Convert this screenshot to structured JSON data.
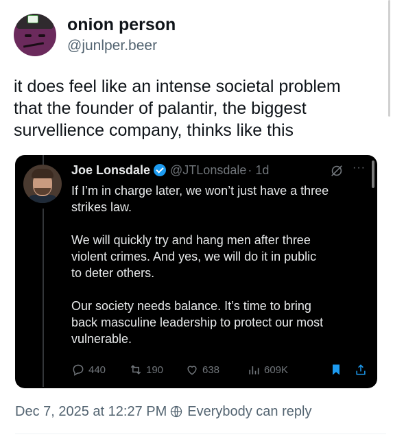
{
  "author": {
    "display_name": "onion person",
    "handle": "@junlper.beer"
  },
  "post": {
    "text": "it does feel like an intense societal problem\nthat the founder of palantir, the biggest\nsurvellience company, thinks like this"
  },
  "quote": {
    "display_name": "Joe Lonsdale",
    "handle": "@JTLonsdale",
    "time": "· 1d",
    "more": "···",
    "text": "If I’m in charge later, we won’t just have a three\nstrikes law.\n\nWe will quickly try and hang men after three\nviolent crimes. And yes, we will do it in public\nto deter others.\n\nOur society needs balance. It’s time to bring\nback masculine leadership to protect our most\nvulnerable.",
    "replies": "440",
    "reposts": "190",
    "likes": "638",
    "views": "609K"
  },
  "meta": {
    "date": "Dec 7, 2025 at 12:27 PM",
    "audience": "Everybody can reply"
  },
  "colors": {
    "accent": "#1d9bf0",
    "quote_bg": "#000000",
    "muted": "#536471"
  }
}
